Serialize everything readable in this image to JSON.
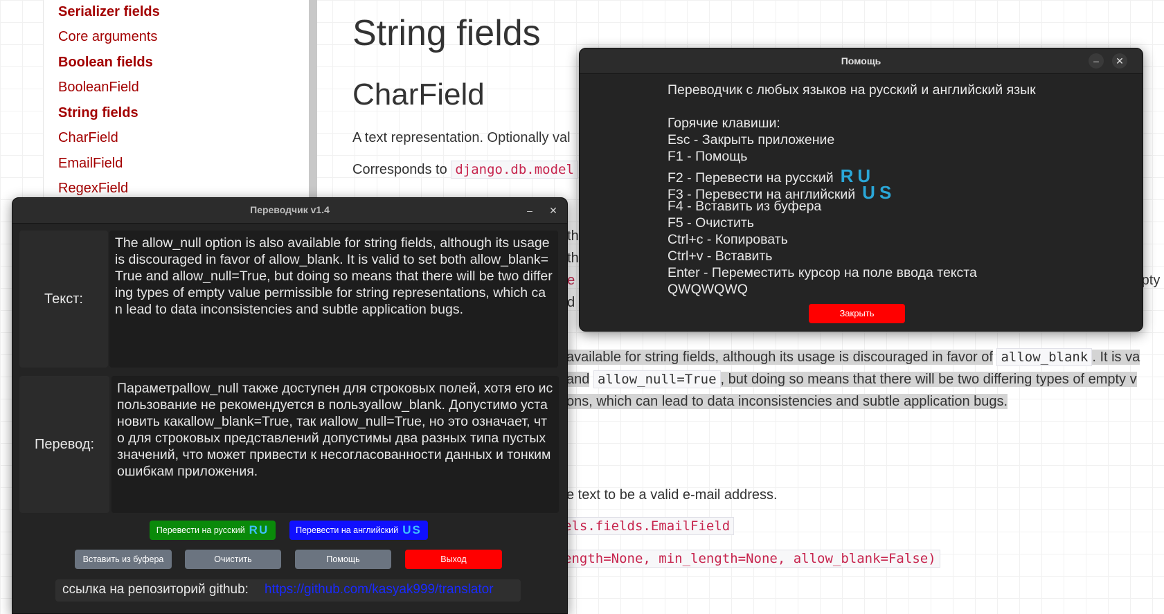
{
  "sidebar": {
    "items": [
      {
        "label": "Serializer fields",
        "bold": true
      },
      {
        "label": "Core arguments",
        "bold": false
      },
      {
        "label": "Boolean fields",
        "bold": true
      },
      {
        "label": "BooleanField",
        "bold": false
      },
      {
        "label": "String fields",
        "bold": true
      },
      {
        "label": "CharField",
        "bold": false
      },
      {
        "label": "EmailField",
        "bold": false
      },
      {
        "label": "RegexField",
        "bold": false
      }
    ]
  },
  "doc": {
    "h1": "String fields",
    "h2": "CharField",
    "p1": "A text representation. Optionally val",
    "corresponds": "Corresponds to",
    "corresponds_code": "django.db.model",
    "sel_line1a": "available for string fields, although its usage is discouraged in favor of",
    "sel_code1": "allow_blank",
    "sel_line1b": ". It is va",
    "sel_line2a": "and",
    "sel_code2": "allow_null=True",
    "sel_line2b": ", but doing so means that there will be two differing types of empty v",
    "sel_line3": "ons, which can lead to data inconsistencies and subtle application bugs.",
    "email_desc": "e text to be a valid e-mail address.",
    "email_code1": "els.fields.EmailField",
    "email_code2": "ength=None, min_length=None, allow_blank=False)",
    "t1": "t th",
    "t2": "t th",
    "t3": "ue",
    "t4": "nd",
    "t5": "o",
    "right_empty": "mpty"
  },
  "translator": {
    "title": "Переводчик v1.4",
    "text_label": "Текст:",
    "text_value": "The allow_null option is also available for string fields, although its usage is discouraged in favor of allow_blank. It is valid to set both allow_blank=True and allow_null=True, but doing so means that there will be two differing types of empty value permissible for string representations, which can lead to data inconsistencies and subtle application bugs.",
    "translation_label": "Перевод:",
    "translation_value": "Параметрallow_null также доступен для строковых полей, хотя его использование не рекомендуется в пользуallow_blank. Допустимо установить какallow_blank=True, так иallow_null=True, но это означает, что для строковых представлений допустимы два разных типа пустых значений, что может привести к несогласованности данных и тонким ошибкам приложения.",
    "btn_ru": "Перевести на русский",
    "btn_ru_flag": "RU",
    "btn_en": "Перевести на английский",
    "btn_en_flag": "US",
    "btn_paste": "Вставить из буфера",
    "btn_clear": "Очистить",
    "btn_help": "Помощь",
    "btn_exit": "Выход",
    "github_label": "ссылка на репозиторий github:",
    "github_link": "https://github.com/kasyak999/translator",
    "colors": {
      "ru": "#0a8a0a",
      "en": "#1010ff",
      "gray": "#6b7480",
      "exit": "#ff0000"
    }
  },
  "help": {
    "title": "Помощь",
    "line1": "Переводчик с любых языков на русский и английский язык",
    "hotkeys_title": "Горячие клавиши:",
    "hk1": "Esc - Закрыть приложение",
    "hk2": "F1 - Помощь",
    "hk3": "F2 - Перевести на русский",
    "hk3_flag": "RU",
    "hk4": "F3 - Перевести на английский",
    "hk4_flag": "US",
    "hk5": "F4 - Вставить из буфера",
    "hk6": "F5 - Очистить",
    "hk7": "Ctrl+c - Копировать",
    "hk8": "Ctrl+v - Вставить",
    "hk9": "Enter - Переместить курсор на поле ввода текста",
    "extra": "QWQWQWQ",
    "close": "Закрыть"
  }
}
